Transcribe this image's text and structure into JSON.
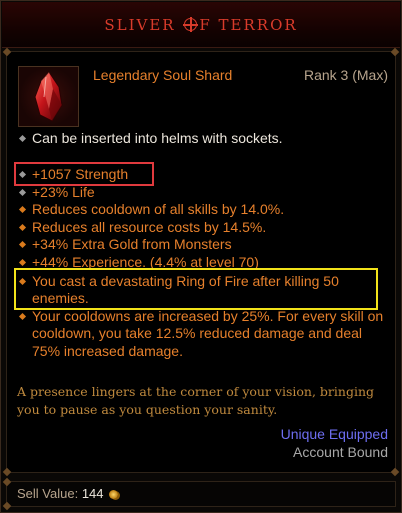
{
  "title": {
    "part1": "SLIVER",
    "part2": "F TERROR",
    "symbol": "title-emblem-icon"
  },
  "item": {
    "type": "Legendary Soul Shard",
    "rank": "Rank 3 (Max)",
    "icon": "blood-shard-icon",
    "socket_text": "Can be inserted into helms with sockets."
  },
  "affixes": [
    "+1057 Strength",
    "+23% Life",
    "Reduces cooldown of all skills by 14.0%.",
    "Reduces all resource costs by 14.5%.",
    "+34% Extra Gold from Monsters",
    "+44% Experience. (4.4% at level 70)"
  ],
  "legendary_power": [
    "You cast a devastating Ring of Fire after killing 50 enemies.",
    "Your cooldowns are increased by 25%. For every skill on cooldown, you take 12.5% reduced damage and deal 75% increased damage."
  ],
  "flavor_text": "A presence lingers at the corner of your vision, bringing you to pause as you question your sanity.",
  "status": {
    "equipped": "Unique Equipped",
    "bound": "Account Bound"
  },
  "footer": {
    "sell_label": "Sell Value:",
    "sell_value": "144",
    "currency_icon": "gold-coin-icon"
  },
  "colors": {
    "title_red": "#d93b2b",
    "legendary_orange": "#e6802c",
    "highlight_red": "#e03a3e",
    "highlight_yellow": "#f2e31a",
    "equipped_blue": "#6e6ef0"
  }
}
